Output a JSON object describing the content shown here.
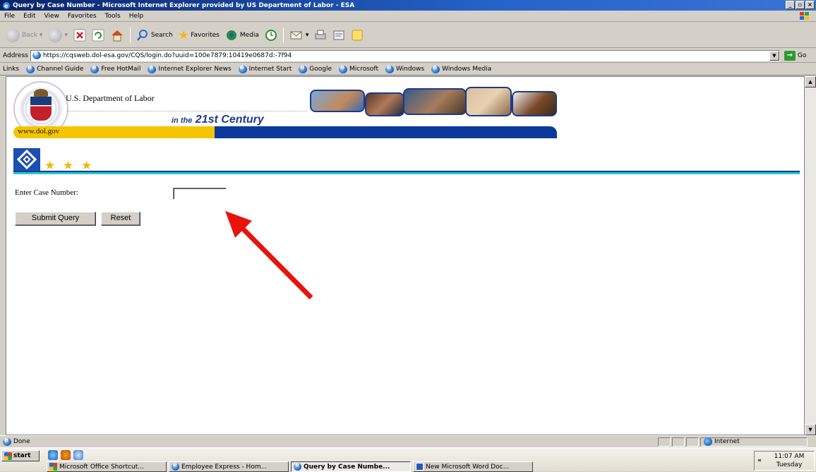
{
  "window": {
    "title": "Query by Case Number - Microsoft Internet Explorer provided by US Department of Labor - ESA",
    "controls": [
      "_",
      "▫",
      "×"
    ]
  },
  "menu": [
    "File",
    "Edit",
    "View",
    "Favorites",
    "Tools",
    "Help"
  ],
  "toolbar": {
    "back": "Back",
    "search": "Search",
    "favorites": "Favorites",
    "media": "Media"
  },
  "address": {
    "label": "Address",
    "url": "https://cqsweb.dol-esa.gov/CQS/login.do?uuid=100e7879:10419e0687d:-7f94",
    "go": "Go"
  },
  "links": {
    "label": "Links",
    "items": [
      "Channel Guide",
      "Free HotMail",
      "Internet Explorer News",
      "Internet Start",
      "Google",
      "Microsoft",
      "Windows",
      "Windows Media"
    ]
  },
  "banner": {
    "org_name": "U.S. Department of Labor",
    "tagline_small": "in the",
    "tagline_big": "21st Century",
    "website": "www.dol.gov"
  },
  "form": {
    "case_label": "Enter Case Number:",
    "case_value": "",
    "submit_label": "Submit Query",
    "reset_label": "Reset"
  },
  "status": {
    "text": "Done",
    "zone": "Internet"
  },
  "taskbar": {
    "start": "start",
    "tasks": [
      "Microsoft Office Shortcut...",
      "Employee Express - Hom...",
      "Query by Case Numbe...",
      "New Microsoft Word Doc..."
    ],
    "active_task": 2,
    "time": "11:07 AM",
    "day": "Tuesday"
  },
  "colors": {
    "annotation_arrow": "#e8140c",
    "dol_blue": "#0b3a9a",
    "dol_gold": "#f5c400"
  }
}
